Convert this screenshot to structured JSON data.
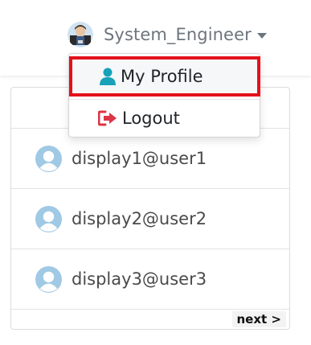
{
  "header": {
    "username": "System_Engineer",
    "avatar_icon": "user-avatar-photo"
  },
  "dropdown": {
    "items": [
      {
        "label": "My Profile",
        "icon": "user-icon",
        "icon_color": "#17a2b8",
        "highlighted": true,
        "highlight_color": "#e3111b"
      },
      {
        "label": "Logout",
        "icon": "sign-out-icon",
        "icon_color": "#dc3545"
      }
    ]
  },
  "list": {
    "users": [
      {
        "label": "display1@user1",
        "icon": "user-avatar-placeholder-icon"
      },
      {
        "label": "display2@user2",
        "icon": "user-avatar-placeholder-icon"
      },
      {
        "label": "display3@user3",
        "icon": "user-avatar-placeholder-icon"
      }
    ],
    "next_label": "next >"
  },
  "colors": {
    "avatar_placeholder": "#9fc9e4",
    "muted_text": "#6c757d"
  }
}
